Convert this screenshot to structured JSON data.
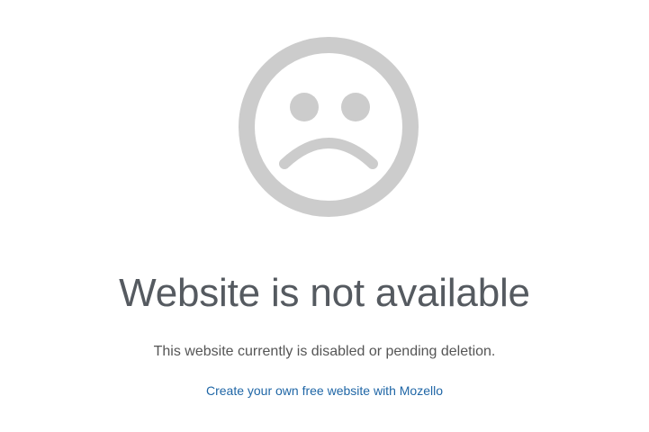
{
  "icon": {
    "name": "sad-face-icon",
    "color": "#cccccc"
  },
  "message": {
    "title": "Website is not available",
    "description": "This website currently is disabled or pending deletion.",
    "link_text": "Create your own free website with Mozello"
  },
  "colors": {
    "title": "#555a60",
    "description": "#555555",
    "link": "#1f66a6",
    "background": "#ffffff"
  }
}
